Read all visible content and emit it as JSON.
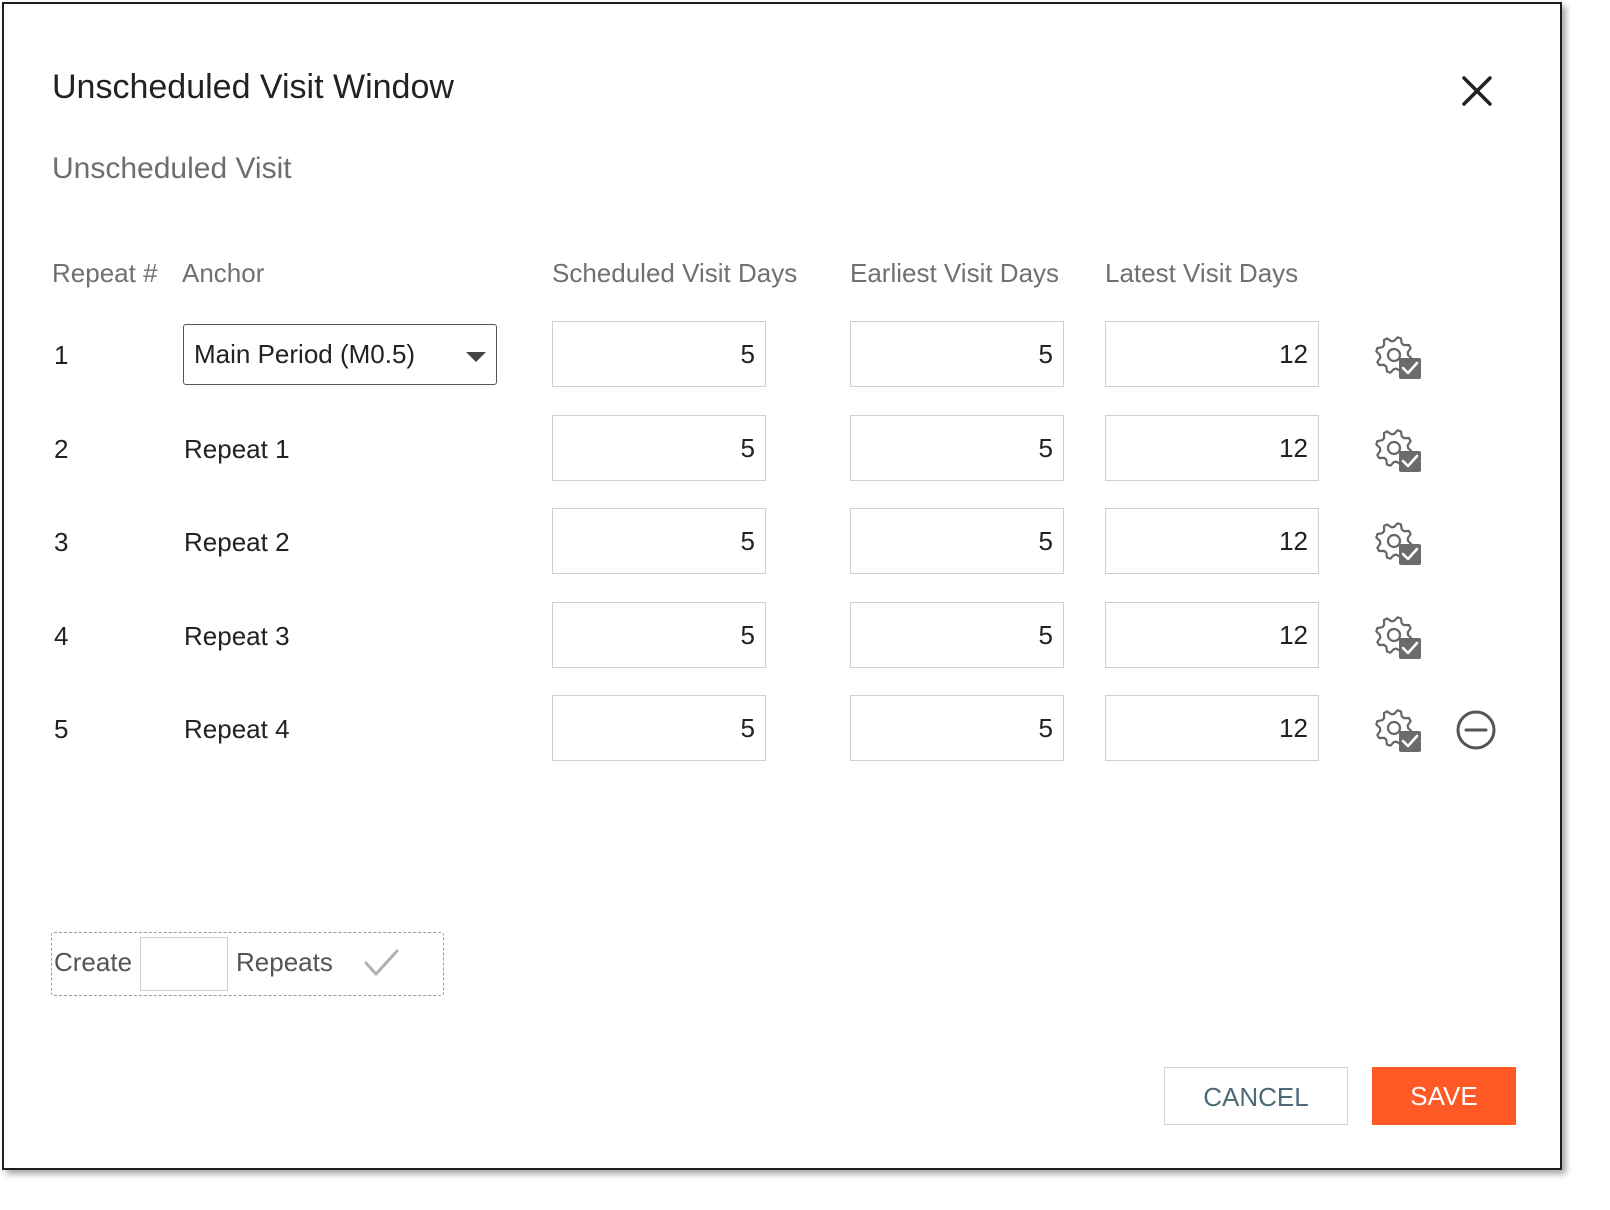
{
  "dialog": {
    "title": "Unscheduled Visit Window",
    "subtitle": "Unscheduled Visit"
  },
  "columns": {
    "repeat": "Repeat #",
    "anchor": "Anchor",
    "scheduled": "Scheduled Visit Days",
    "earliest": "Earliest Visit Days",
    "latest": "Latest Visit Days"
  },
  "rows": [
    {
      "num": "1",
      "anchor": "Main Period (M0.5)",
      "scheduled": "5",
      "earliest": "5",
      "latest": "12"
    },
    {
      "num": "2",
      "anchor": "Repeat 1",
      "scheduled": "5",
      "earliest": "5",
      "latest": "12"
    },
    {
      "num": "3",
      "anchor": "Repeat 2",
      "scheduled": "5",
      "earliest": "5",
      "latest": "12"
    },
    {
      "num": "4",
      "anchor": "Repeat 3",
      "scheduled": "5",
      "earliest": "5",
      "latest": "12"
    },
    {
      "num": "5",
      "anchor": "Repeat 4",
      "scheduled": "5",
      "earliest": "5",
      "latest": "12"
    }
  ],
  "create_repeats": {
    "create_label": "Create",
    "count_value": "",
    "repeats_label": "Repeats"
  },
  "buttons": {
    "cancel": "CANCEL",
    "save": "SAVE"
  },
  "icons": {
    "close": "close-icon",
    "row_settings": "gear-check-icon",
    "remove": "minus-circle-icon",
    "confirm": "checkmark-icon"
  },
  "colors": {
    "accent": "#ff5a26",
    "cancel_text": "#4e6a78",
    "icon": "#666666"
  }
}
